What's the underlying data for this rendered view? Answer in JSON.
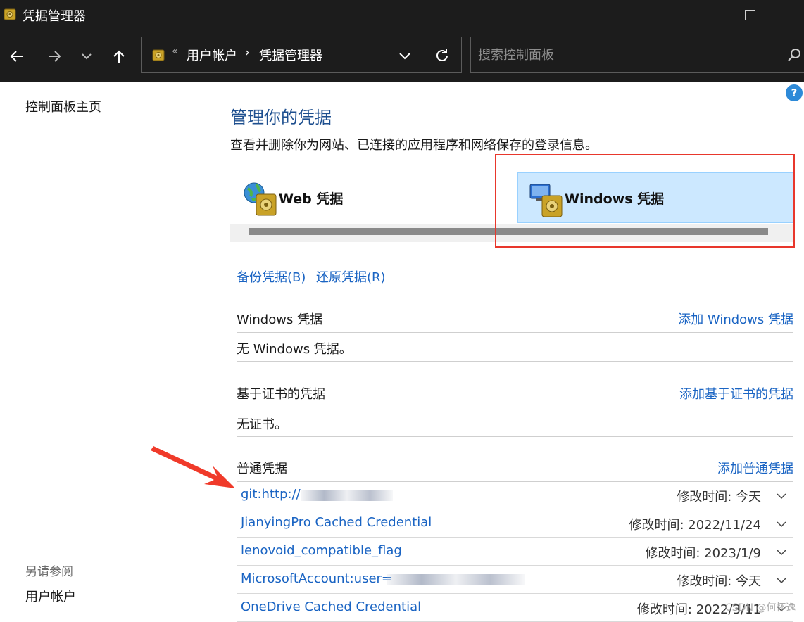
{
  "window": {
    "title": "凭据管理器"
  },
  "address": {
    "sep0": "«",
    "crumbs": [
      "用户帐户",
      "凭据管理器"
    ],
    "sep": "›"
  },
  "search": {
    "placeholder": "搜索控制面板",
    "value": ""
  },
  "left": {
    "home": "控制面板主页",
    "see_also": "另请参阅",
    "user_accounts": "用户帐户"
  },
  "help": "?",
  "main": {
    "title": "管理你的凭据",
    "description": "查看并删除你为网站、已连接的应用程序和网络保存的登录信息。",
    "tiles": {
      "web": "Web 凭据",
      "windows": "Windows 凭据",
      "selected": "windows"
    },
    "backup": "备份凭据(B)",
    "restore": "还原凭据(R)",
    "sections": {
      "windows": {
        "title": "Windows 凭据",
        "add": "添加 Windows 凭据",
        "empty": "无 Windows 凭据。"
      },
      "certificate": {
        "title": "基于证书的凭据",
        "add": "添加基于证书的凭据",
        "empty": "无证书。"
      },
      "generic": {
        "title": "普通凭据",
        "add": "添加普通凭据",
        "items": [
          {
            "name": "git:http://",
            "modified": "修改时间:  今天"
          },
          {
            "name": "JianyingPro Cached Credential",
            "modified": "修改时间:  2022/11/24"
          },
          {
            "name": "lenovoid_compatible_flag",
            "modified": "修改时间:  2023/1/9"
          },
          {
            "name": "MicrosoftAccount:user=",
            "modified": "修改时间:  今天"
          },
          {
            "name": "OneDrive Cached Credential",
            "modified": "修改时间:  2022/3/11"
          }
        ]
      }
    }
  },
  "watermark": "CSDN @何怀逸",
  "colors": {
    "link": "#1a64c3",
    "title": "#1e4f8f",
    "selected_tile": "#cce8ff",
    "highlight_box": "#e8372c",
    "titlebar": "#1c1c1c"
  }
}
